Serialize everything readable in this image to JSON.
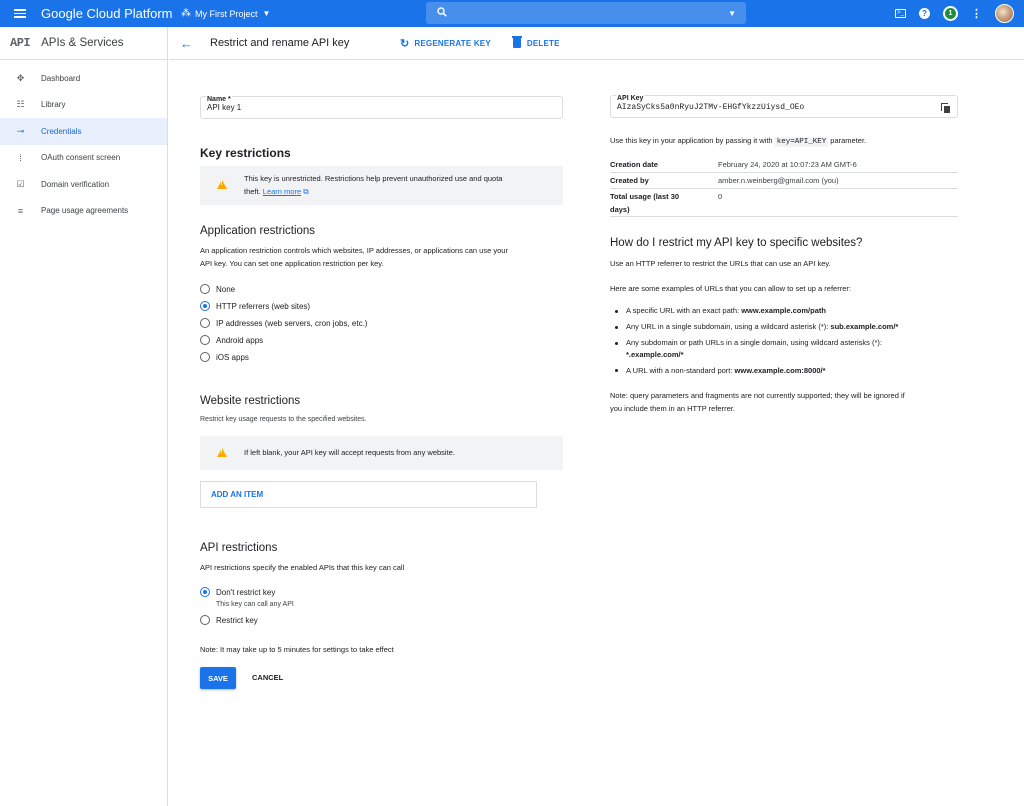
{
  "topbar": {
    "brand": "Google Cloud Platform",
    "project": "My First Project",
    "notification_count": "1"
  },
  "sidebar": {
    "logo": "API",
    "title": "APIs & Services",
    "items": [
      {
        "label": "Dashboard",
        "icon": "dashboard-icon"
      },
      {
        "label": "Library",
        "icon": "library-icon"
      },
      {
        "label": "Credentials",
        "icon": "key-icon",
        "active": true
      },
      {
        "label": "OAuth consent screen",
        "icon": "consent-icon"
      },
      {
        "label": "Domain verification",
        "icon": "domain-icon"
      },
      {
        "label": "Page usage agreements",
        "icon": "agreements-icon"
      }
    ]
  },
  "actionbar": {
    "title": "Restrict and rename API key",
    "regenerate": "REGENERATE KEY",
    "delete": "DELETE"
  },
  "form": {
    "name_label": "Name *",
    "name_value": "API key 1",
    "key_restrictions_heading": "Key restrictions",
    "unrestricted_warning_line1": "This key is unrestricted. Restrictions help prevent unauthorized use and quota",
    "unrestricted_warning_line2": "theft.",
    "learn_more": "Learn more",
    "app_restrictions_heading": "Application restrictions",
    "app_restrictions_desc_line1": "An application restriction controls which websites, IP addresses, or applications can use your",
    "app_restrictions_desc_line2": "API key. You can set one application restriction per key.",
    "app_options": [
      "None",
      "HTTP referrers (web sites)",
      "IP addresses (web servers, cron jobs, etc.)",
      "Android apps",
      "iOS apps"
    ],
    "app_selected": 1,
    "website_heading": "Website restrictions",
    "website_desc": "Restrict key usage requests to the specified websites.",
    "website_warning": "If left blank, your API key will accept requests from any website.",
    "add_item": "ADD AN ITEM",
    "api_restrictions_heading": "API restrictions",
    "api_restrictions_desc": "API restrictions specify the enabled APIs that this key can call",
    "api_option_dont": "Don't restrict key",
    "api_option_dont_sub": "This key can call any API",
    "api_option_restrict": "Restrict key",
    "settings_note": "Note: It may take up to 5 minutes for settings to take effect",
    "save": "SAVE",
    "cancel": "CANCEL"
  },
  "keyinfo": {
    "label": "API Key",
    "value": "AIzaSyCks5a0nRyuJ2TMv-EHGfYkzzUiysd_OEo",
    "usage_prefix": "Use this key in your application by passing it with",
    "usage_code": "key=API_KEY",
    "usage_suffix": "parameter.",
    "rows": [
      {
        "k": "Creation date",
        "v": "February 24, 2020 at 10:07:23 AM GMT-6"
      },
      {
        "k": "Created by",
        "v": "amber.n.weinberg@gmail.com (you)"
      },
      {
        "k": "Total usage (last 30 days)",
        "v": "0"
      }
    ]
  },
  "help": {
    "heading": "How do I restrict my API key to specific websites?",
    "intro": "Use an HTTP referrer to restrict the URLs that can use an API key.",
    "examples_intro": "Here are some examples of URLs that you can allow to set up a referrer:",
    "b1_text": "A specific URL with an exact path: ",
    "b1_bold": "www.example.com/path",
    "b2_text": "Any URL in a single subdomain, using a wildcard asterisk (*): ",
    "b2_bold": "sub.example.com/*",
    "b3_text": "Any subdomain or path URLs in a single domain, using wildcard asterisks (*):",
    "b3_bold": "*.example.com/*",
    "b4_text": "A URL with a non-standard port: ",
    "b4_bold": "www.example.com:8000/*",
    "note_line1": "Note: query parameters and fragments are not currently supported; they will be ignored if",
    "note_line2": "you include them in an HTTP referrer."
  },
  "colors": {
    "accent": "#1a73e8",
    "warning": "#f9ab00",
    "active_bg": "#e8f0fe"
  }
}
